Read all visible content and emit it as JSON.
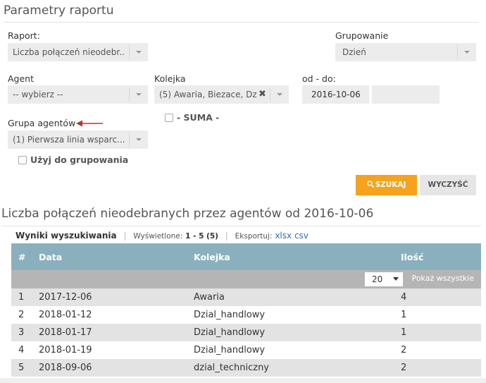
{
  "section_title": "Parametry raportu",
  "report": {
    "label": "Raport:",
    "value": "Liczba połączeń nieodebr..."
  },
  "grouping": {
    "label": "Grupowanie",
    "value": "Dzień"
  },
  "agent": {
    "label": "Agent",
    "value": "-- wybierz --"
  },
  "queue": {
    "label": "Kolejka",
    "value": "(5) Awaria, Biezace, Dz...",
    "clear": "✖"
  },
  "date": {
    "label": "od - do:",
    "from": "2016-10-06",
    "to": ""
  },
  "agent_group": {
    "label": "Grupa agentów",
    "value": "(1) Pierwsza linia wsparc..."
  },
  "suma_label": "- SUMA -",
  "use_grouping_label": "Użyj do grupowania",
  "search_button": "SZUKAJ",
  "clear_button": "WYCZYŚĆ",
  "result_title": "Liczba połączeń nieodebranych przez agentów od 2016-10-06",
  "results_bar": {
    "tab": "Wyniki wyszukiwania",
    "shown_label": "Wyświetlone:",
    "shown_value": "1 - 5 (5)",
    "export_label": "Eksportuj:",
    "xlsx": "xlsx",
    "csv": "csv"
  },
  "table": {
    "headers": [
      "#",
      "Data",
      "Kolejka",
      "Ilość"
    ],
    "page_size": "20",
    "show_all": "Pokaż wszystkie",
    "rows": [
      [
        "1",
        "2017-12-06",
        "Awaria",
        "4"
      ],
      [
        "2",
        "2018-01-12",
        "Dzial_handlowy",
        "1"
      ],
      [
        "3",
        "2018-01-17",
        "Dzial_handlowy",
        "1"
      ],
      [
        "4",
        "2018-01-19",
        "Dzial_handlowy",
        "2"
      ],
      [
        "5",
        "2018-09-06",
        "dzial_techniczny",
        "2"
      ]
    ]
  },
  "colors": {
    "accent": "#f5a21d",
    "table_header": "#8bb0bd",
    "arrow": "#c0302a",
    "link": "#2a6fb0"
  }
}
